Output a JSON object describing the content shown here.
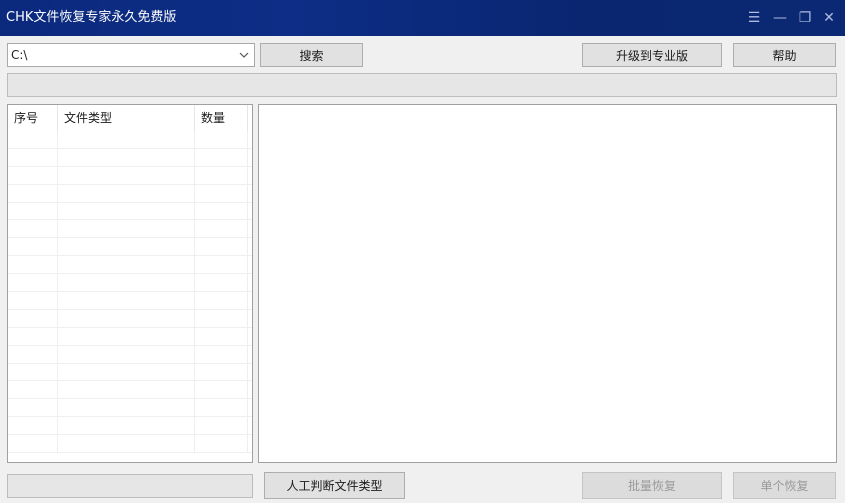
{
  "window": {
    "title": "CHK文件恢复专家永久免费版",
    "controls": {
      "menu": "☰",
      "minimize": "—",
      "restore": "❐",
      "close": "✕"
    }
  },
  "toolbar": {
    "drive_value": "C:\\",
    "search_label": "搜索",
    "upgrade_label": "升级到专业版",
    "help_label": "帮助"
  },
  "progress": {
    "value": 0
  },
  "list": {
    "columns": [
      "序号",
      "文件类型",
      "数量"
    ],
    "rows": [
      [
        "",
        "",
        ""
      ],
      [
        "",
        "",
        ""
      ],
      [
        "",
        "",
        ""
      ],
      [
        "",
        "",
        ""
      ],
      [
        "",
        "",
        ""
      ],
      [
        "",
        "",
        ""
      ],
      [
        "",
        "",
        ""
      ],
      [
        "",
        "",
        ""
      ],
      [
        "",
        "",
        ""
      ],
      [
        "",
        "",
        ""
      ],
      [
        "",
        "",
        ""
      ],
      [
        "",
        "",
        ""
      ],
      [
        "",
        "",
        ""
      ],
      [
        "",
        "",
        ""
      ],
      [
        "",
        "",
        ""
      ],
      [
        "",
        "",
        ""
      ],
      [
        "",
        "",
        ""
      ],
      [
        "",
        "",
        ""
      ]
    ]
  },
  "bottom": {
    "manual_label": "人工判断文件类型",
    "batch_label": "批量恢复",
    "single_label": "单个恢复"
  },
  "colors": {
    "titlebar": "#0b2a7e",
    "button_bg": "#e1e1e1",
    "disabled_text": "#9a9a9a"
  }
}
